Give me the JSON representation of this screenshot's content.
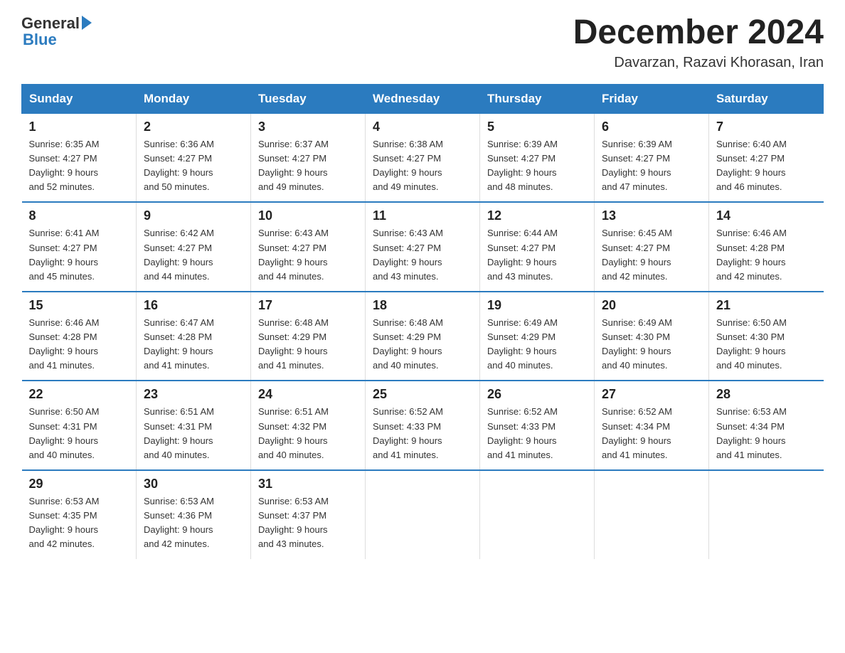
{
  "header": {
    "month_title": "December 2024",
    "location": "Davarzan, Razavi Khorasan, Iran"
  },
  "logo": {
    "general": "General",
    "blue": "Blue"
  },
  "weekdays": [
    "Sunday",
    "Monday",
    "Tuesday",
    "Wednesday",
    "Thursday",
    "Friday",
    "Saturday"
  ],
  "weeks": [
    [
      {
        "day": "1",
        "info": "Sunrise: 6:35 AM\nSunset: 4:27 PM\nDaylight: 9 hours\nand 52 minutes."
      },
      {
        "day": "2",
        "info": "Sunrise: 6:36 AM\nSunset: 4:27 PM\nDaylight: 9 hours\nand 50 minutes."
      },
      {
        "day": "3",
        "info": "Sunrise: 6:37 AM\nSunset: 4:27 PM\nDaylight: 9 hours\nand 49 minutes."
      },
      {
        "day": "4",
        "info": "Sunrise: 6:38 AM\nSunset: 4:27 PM\nDaylight: 9 hours\nand 49 minutes."
      },
      {
        "day": "5",
        "info": "Sunrise: 6:39 AM\nSunset: 4:27 PM\nDaylight: 9 hours\nand 48 minutes."
      },
      {
        "day": "6",
        "info": "Sunrise: 6:39 AM\nSunset: 4:27 PM\nDaylight: 9 hours\nand 47 minutes."
      },
      {
        "day": "7",
        "info": "Sunrise: 6:40 AM\nSunset: 4:27 PM\nDaylight: 9 hours\nand 46 minutes."
      }
    ],
    [
      {
        "day": "8",
        "info": "Sunrise: 6:41 AM\nSunset: 4:27 PM\nDaylight: 9 hours\nand 45 minutes."
      },
      {
        "day": "9",
        "info": "Sunrise: 6:42 AM\nSunset: 4:27 PM\nDaylight: 9 hours\nand 44 minutes."
      },
      {
        "day": "10",
        "info": "Sunrise: 6:43 AM\nSunset: 4:27 PM\nDaylight: 9 hours\nand 44 minutes."
      },
      {
        "day": "11",
        "info": "Sunrise: 6:43 AM\nSunset: 4:27 PM\nDaylight: 9 hours\nand 43 minutes."
      },
      {
        "day": "12",
        "info": "Sunrise: 6:44 AM\nSunset: 4:27 PM\nDaylight: 9 hours\nand 43 minutes."
      },
      {
        "day": "13",
        "info": "Sunrise: 6:45 AM\nSunset: 4:27 PM\nDaylight: 9 hours\nand 42 minutes."
      },
      {
        "day": "14",
        "info": "Sunrise: 6:46 AM\nSunset: 4:28 PM\nDaylight: 9 hours\nand 42 minutes."
      }
    ],
    [
      {
        "day": "15",
        "info": "Sunrise: 6:46 AM\nSunset: 4:28 PM\nDaylight: 9 hours\nand 41 minutes."
      },
      {
        "day": "16",
        "info": "Sunrise: 6:47 AM\nSunset: 4:28 PM\nDaylight: 9 hours\nand 41 minutes."
      },
      {
        "day": "17",
        "info": "Sunrise: 6:48 AM\nSunset: 4:29 PM\nDaylight: 9 hours\nand 41 minutes."
      },
      {
        "day": "18",
        "info": "Sunrise: 6:48 AM\nSunset: 4:29 PM\nDaylight: 9 hours\nand 40 minutes."
      },
      {
        "day": "19",
        "info": "Sunrise: 6:49 AM\nSunset: 4:29 PM\nDaylight: 9 hours\nand 40 minutes."
      },
      {
        "day": "20",
        "info": "Sunrise: 6:49 AM\nSunset: 4:30 PM\nDaylight: 9 hours\nand 40 minutes."
      },
      {
        "day": "21",
        "info": "Sunrise: 6:50 AM\nSunset: 4:30 PM\nDaylight: 9 hours\nand 40 minutes."
      }
    ],
    [
      {
        "day": "22",
        "info": "Sunrise: 6:50 AM\nSunset: 4:31 PM\nDaylight: 9 hours\nand 40 minutes."
      },
      {
        "day": "23",
        "info": "Sunrise: 6:51 AM\nSunset: 4:31 PM\nDaylight: 9 hours\nand 40 minutes."
      },
      {
        "day": "24",
        "info": "Sunrise: 6:51 AM\nSunset: 4:32 PM\nDaylight: 9 hours\nand 40 minutes."
      },
      {
        "day": "25",
        "info": "Sunrise: 6:52 AM\nSunset: 4:33 PM\nDaylight: 9 hours\nand 41 minutes."
      },
      {
        "day": "26",
        "info": "Sunrise: 6:52 AM\nSunset: 4:33 PM\nDaylight: 9 hours\nand 41 minutes."
      },
      {
        "day": "27",
        "info": "Sunrise: 6:52 AM\nSunset: 4:34 PM\nDaylight: 9 hours\nand 41 minutes."
      },
      {
        "day": "28",
        "info": "Sunrise: 6:53 AM\nSunset: 4:34 PM\nDaylight: 9 hours\nand 41 minutes."
      }
    ],
    [
      {
        "day": "29",
        "info": "Sunrise: 6:53 AM\nSunset: 4:35 PM\nDaylight: 9 hours\nand 42 minutes."
      },
      {
        "day": "30",
        "info": "Sunrise: 6:53 AM\nSunset: 4:36 PM\nDaylight: 9 hours\nand 42 minutes."
      },
      {
        "day": "31",
        "info": "Sunrise: 6:53 AM\nSunset: 4:37 PM\nDaylight: 9 hours\nand 43 minutes."
      },
      {
        "day": "",
        "info": ""
      },
      {
        "day": "",
        "info": ""
      },
      {
        "day": "",
        "info": ""
      },
      {
        "day": "",
        "info": ""
      }
    ]
  ]
}
